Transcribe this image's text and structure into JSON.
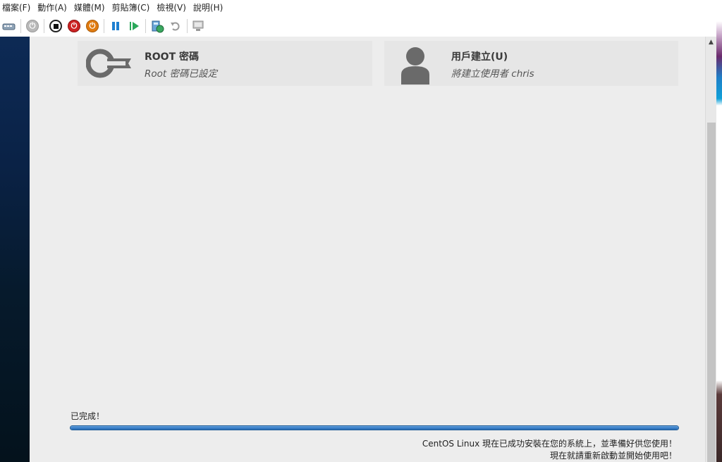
{
  "menu": [
    "檔案(F)",
    "動作(A)",
    "媒體(M)",
    "剪貼簿(C)",
    "檢視(V)",
    "說明(H)"
  ],
  "toolbar": {
    "icons": [
      "ctrl-alt-del-icon",
      "power-on-icon",
      "turn-off-icon",
      "shutdown-icon",
      "reset-icon",
      "pause-icon",
      "resume-icon",
      "checkpoint-icon",
      "revert-icon",
      "enhanced-session-icon"
    ]
  },
  "cards": {
    "root": {
      "title": "ROOT 密碼",
      "subtitle": "Root 密碼已設定"
    },
    "user": {
      "title": "用戶建立(U)",
      "subtitle": "將建立使用者 chris"
    }
  },
  "status": {
    "done": "已完成！",
    "progress": 1.0,
    "message_line1": "CentOS Linux 現在已成功安裝在您的系統上，並準備好供您使用！",
    "message_line2": "現在就請重新啟動並開始使用吧！"
  },
  "colors": {
    "progress_fill": "#3a7fc8",
    "stop_red": "#cc2222",
    "shutdown_orange": "#e07b10",
    "pause_blue": "#1e7fd0",
    "resume_green": "#2aa85a"
  }
}
